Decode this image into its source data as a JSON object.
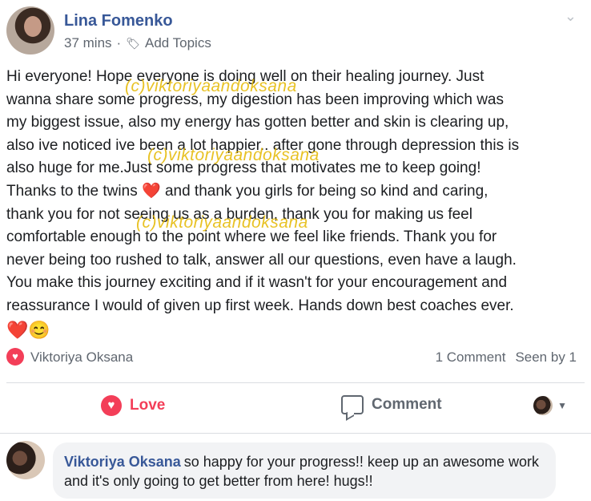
{
  "post": {
    "author": "Lina Fomenko",
    "time": "37 mins",
    "separator": "·",
    "add_topics": "Add Topics",
    "body_lines": [
      "Hi everyone! Hope everyone is doing well on their healing journey. Just",
      "wanna share some progress, my digestion has been improving which was",
      "my biggest issue, also my energy has gotten better and skin is clearing up,",
      "also ive noticed ive been a lot happier.. after gone through depression this is",
      "also huge for me.Just some progress that motivates me to keep going!",
      "Thanks to the twins",
      "and thank you girls for being so kind and caring,",
      "thank you for not seeing us as a burden, thank you for making us feel",
      "comfortable enough to the point where we feel like friends. Thank you for",
      "never being too rushed to talk, answer all our questions, even have a laugh.",
      "You make this journey exciting and if it wasn't for your encouragement and",
      "reassurance I would of given up first week. Hands down best coaches ever."
    ],
    "emoji_heart": "❤️",
    "emoji_smile": "😊"
  },
  "watermark": "(c)viktoriyaandoksana",
  "reactions": {
    "reactor_name": "Viktoriya Oksana",
    "comments_count": "1 Comment",
    "seen_by": "Seen by 1"
  },
  "actions": {
    "love": "Love",
    "comment": "Comment"
  },
  "comment": {
    "author": "Viktoriya Oksana",
    "text": "so happy for your progress!! keep up an awesome work and it's only going to get better from here! hugs!!"
  },
  "icons": [
    "chevron-down-icon",
    "tag-icon",
    "love-icon",
    "comment-icon",
    "caret-down-icon"
  ],
  "colors": {
    "link": "#385898",
    "love": "#f33e58",
    "watermark": "#e5b800"
  }
}
